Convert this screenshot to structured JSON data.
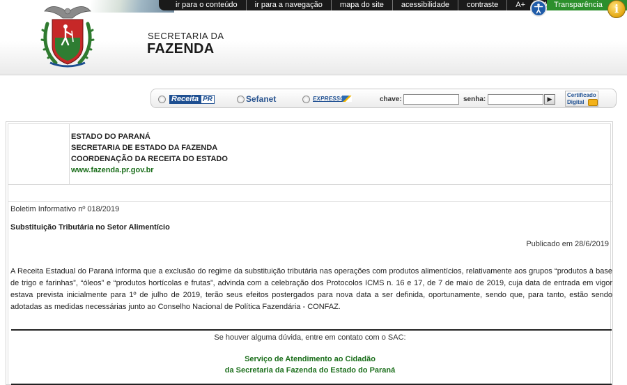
{
  "topnav": {
    "links": [
      "ir para o conteúdo",
      "ir para a navegação",
      "mapa do site",
      "acessibilidade",
      "contraste",
      "A+",
      "A"
    ],
    "transparency": "Transparência",
    "info_glyph": "i"
  },
  "brand": {
    "line1": "SECRETARIA DA",
    "line2": "FAZENDA",
    "emblem_icon": "parana-coat-of-arms-icon"
  },
  "login": {
    "systems": [
      {
        "name": "ReceitaPR",
        "part1": "Receita",
        "part2": "PR"
      },
      {
        "name": "Sefanet"
      },
      {
        "name": "EXPRESSO"
      }
    ],
    "user_label": "chave:",
    "password_label": "senha:",
    "go_glyph": "▶",
    "cert_line1": "Certificado",
    "cert_line2": "Digital"
  },
  "document": {
    "header_lines": [
      "ESTADO DO PARANÁ",
      "SECRETARIA DE ESTADO DA FAZENDA",
      "COORDENAÇÃO DA RECEITA DO ESTADO",
      "www.fazenda.pr.gov.br"
    ],
    "boletim": "Boletim Informativo nº 018/2019",
    "title": "Substituição Tributária no Setor Alimentício",
    "published": "Publicado em 28/6/2019",
    "body": "A Receita Estadual do Paraná informa que a exclusão do regime da substituição tributária nas operações com produtos alimentícios, relativamente aos grupos “produtos à base de trigo e farinhas”, “óleos” e “produtos hortícolas e frutas”, advinda com a celebração dos Protocolos ICMS n. 16 e 17, de 7 de maio de 2019, cuja data de entrada em vigor estava prevista inicialmente para 1º de julho de 2019, terão seus efeitos postergados para nova data a ser definida, oportunamente, sendo que, para tanto, estão sendo adotadas as medidas necessárias junto ao Conselho Nacional de Política Fazendária - CONFAZ.",
    "contact_intro": "Se houver alguma dúvida, entre em contato com o SAC:",
    "sac_line1": "Serviço de Atendimento ao Cidadão",
    "sac_line2": "da Secretaria da Fazenda do Estado do Paraná"
  },
  "colors": {
    "topbar": "#1a1a1a",
    "transparency_green": "#2c8f2c",
    "accent_green": "#1b6e1b",
    "brand_blue": "#1e4f91"
  }
}
